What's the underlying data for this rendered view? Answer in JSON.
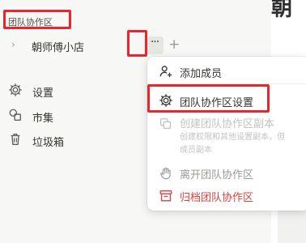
{
  "main": {
    "title": "朝"
  },
  "sidebar": {
    "section_label": "团队协作区",
    "team": {
      "name": "朝师傅小店",
      "more_label": "···",
      "add_label": "+"
    },
    "nav": [
      {
        "label": "设置",
        "icon": "gear-icon"
      },
      {
        "label": "市集",
        "icon": "shapes-icon"
      },
      {
        "label": "垃圾箱",
        "icon": "trash-icon"
      }
    ]
  },
  "menu": {
    "add_member": "添加成员",
    "team_settings": "团队协作区设置",
    "create_copy": {
      "label": "创建团队协作区副本",
      "desc_line1": "创建权限和其他设置副本，但",
      "desc_line2": "成员副本"
    },
    "leave": "离开团队协作区",
    "archive": "归档团队协作区"
  },
  "colors": {
    "highlight": "#e8262d",
    "danger": "#e03e3e",
    "disabled": "#c4c3c0"
  }
}
